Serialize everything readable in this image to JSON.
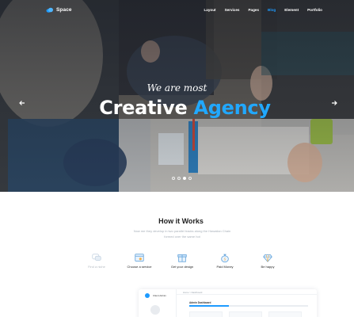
{
  "brand": {
    "name": "Space",
    "accent": "#1e9bff"
  },
  "nav": {
    "items": [
      {
        "label": "Layout",
        "active": false
      },
      {
        "label": "Services",
        "active": false
      },
      {
        "label": "Pages",
        "active": false
      },
      {
        "label": "Blog",
        "active": true
      },
      {
        "label": "Element",
        "active": false
      },
      {
        "label": "Portfolio",
        "active": false
      }
    ]
  },
  "hero": {
    "subtitle": "We are most",
    "title_white": "Creative",
    "title_accent": "Agency",
    "slides_count": 4,
    "active_slide": 3,
    "prev_icon": "arrow-left-icon",
    "next_icon": "arrow-right-icon"
  },
  "how": {
    "title": "How it Works",
    "description": "Now me they develop in two parallel tracks along the Hawaiian Chain formed over the same hot"
  },
  "steps": [
    {
      "label": "Find a niche",
      "icon": "chat-icon",
      "muted": true
    },
    {
      "label": "Choose a service",
      "icon": "browser-icon",
      "muted": false
    },
    {
      "label": "Get your design",
      "icon": "gift-icon",
      "muted": false
    },
    {
      "label": "Paid Money",
      "icon": "money-bag-icon",
      "muted": false
    },
    {
      "label": "Be happy",
      "icon": "diamond-icon",
      "muted": false
    }
  ],
  "dashboard": {
    "user_name": "Client Admin",
    "breadcrumb": "Home  >  Dashboard",
    "title": "Admin Dashboard"
  }
}
